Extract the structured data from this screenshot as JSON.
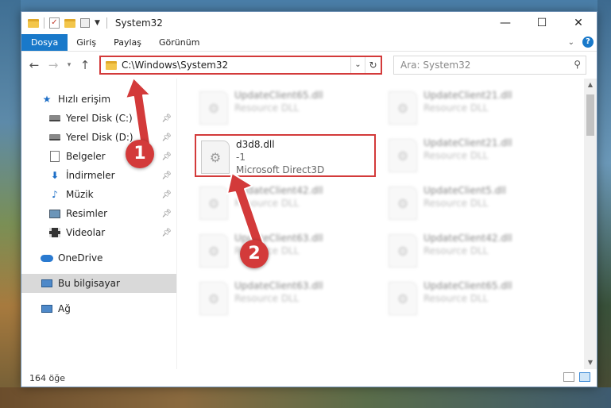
{
  "window": {
    "title": "System32",
    "controls": {
      "minimize": "—",
      "maximize": "☐",
      "close": "✕"
    }
  },
  "ribbon": {
    "tabs": [
      "Dosya",
      "Giriş",
      "Paylaş",
      "Görünüm"
    ],
    "help": "?"
  },
  "address": {
    "path": "C:\\Windows\\System32",
    "search_placeholder": "Ara: System32"
  },
  "sidebar": {
    "quick_access": "Hızlı erişim",
    "items": [
      "Yerel Disk (C:)",
      "Yerel Disk (D:)",
      "Belgeler",
      "İndirmeler",
      "Müzik",
      "Resimler",
      "Videolar"
    ],
    "onedrive": "OneDrive",
    "this_pc": "Bu bilgisayar",
    "network": "Ağ"
  },
  "files": {
    "highlighted": {
      "name": "d3d8.dll",
      "line2": "-1",
      "line3": "Microsoft Direct3D"
    },
    "left": [
      {
        "name": "UpdateClient65.dll",
        "sub": "Resource DLL"
      },
      {
        "name": "UpdateClient42.dll",
        "sub": "Resource DLL"
      },
      {
        "name": "UpdateClient63.dll",
        "sub": "Resource DLL"
      },
      {
        "name": "UpdateClient63.dll",
        "sub": "Resource DLL"
      }
    ],
    "right": [
      {
        "name": "UpdateClient21.dll",
        "sub": "Resource DLL"
      },
      {
        "name": "UpdateClient21.dll",
        "sub": "Resource DLL"
      },
      {
        "name": "UpdateClient5.dll",
        "sub": "Resource DLL"
      },
      {
        "name": "UpdateClient42.dll",
        "sub": "Resource DLL"
      },
      {
        "name": "UpdateClient65.dll",
        "sub": "Resource DLL"
      }
    ]
  },
  "status": {
    "count": "164 öğe"
  },
  "annotations": {
    "step1": "1",
    "step2": "2"
  }
}
